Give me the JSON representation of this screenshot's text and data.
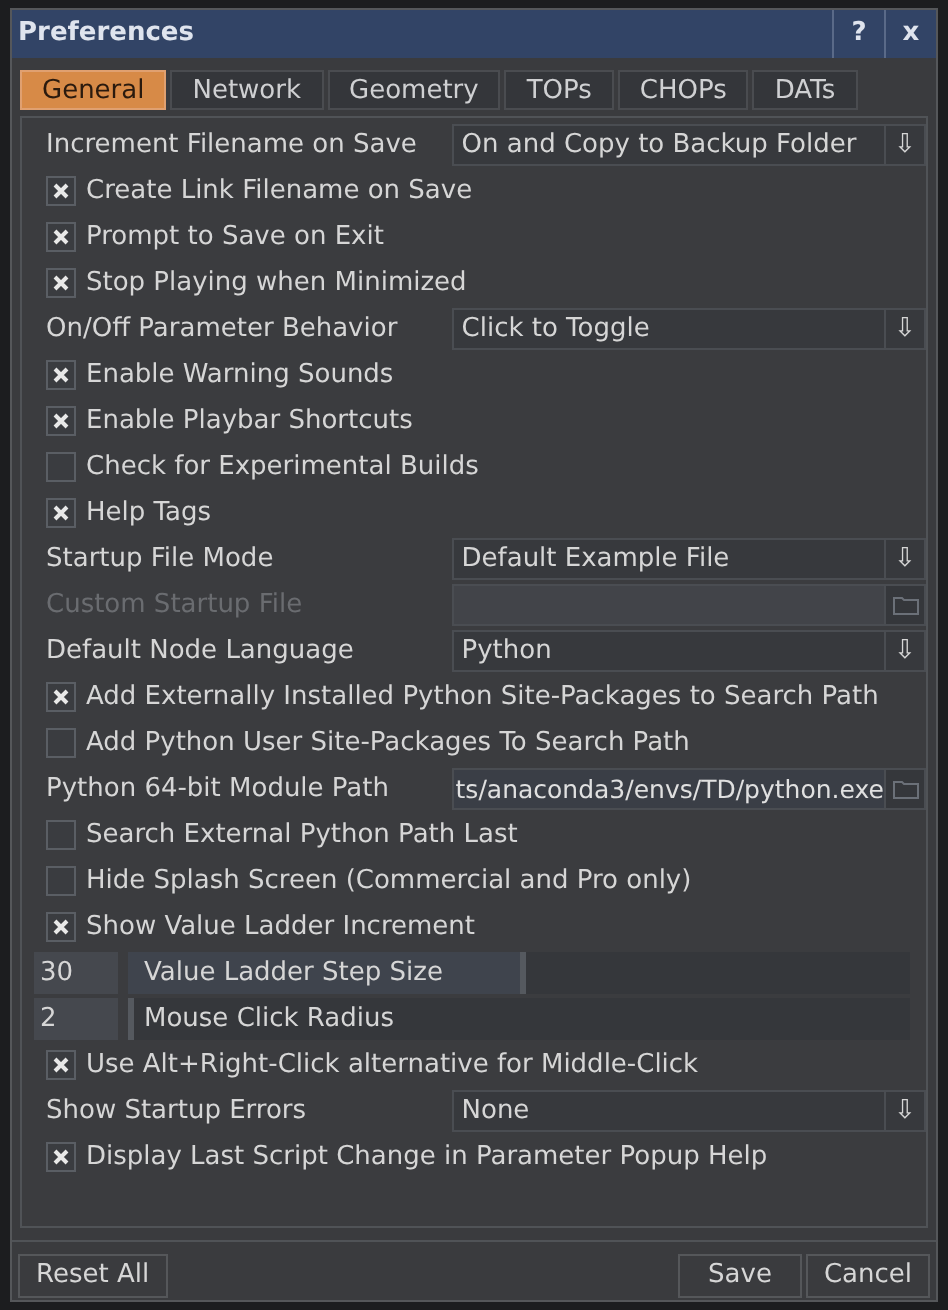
{
  "window": {
    "title": "Preferences",
    "help_button": "?",
    "close_button": "x"
  },
  "tabs": [
    {
      "label": "General",
      "selected": true
    },
    {
      "label": "Network",
      "selected": false
    },
    {
      "label": "Geometry",
      "selected": false
    },
    {
      "label": "TOPs",
      "selected": false
    },
    {
      "label": "CHOPs",
      "selected": false
    },
    {
      "label": "DATs",
      "selected": false
    }
  ],
  "rows": [
    {
      "kind": "menu",
      "label": "Increment Filename on Save",
      "value": "On and Copy to Backup Folder",
      "arrow": "⇩"
    },
    {
      "kind": "check",
      "label": "Create Link Filename on Save",
      "checked": true
    },
    {
      "kind": "check",
      "label": "Prompt to Save on Exit",
      "checked": true
    },
    {
      "kind": "check",
      "label": "Stop Playing when Minimized",
      "checked": true
    },
    {
      "kind": "menu",
      "label": "On/Off Parameter Behavior",
      "value": "Click to Toggle",
      "arrow": "⇩"
    },
    {
      "kind": "check",
      "label": "Enable Warning Sounds",
      "checked": true
    },
    {
      "kind": "check",
      "label": "Enable Playbar Shortcuts",
      "checked": true
    },
    {
      "kind": "check",
      "label": "Check for Experimental Builds",
      "checked": false
    },
    {
      "kind": "check",
      "label": "Help Tags",
      "checked": true
    },
    {
      "kind": "menu",
      "label": "Startup File Mode",
      "value": "Default Example File",
      "arrow": "⇩"
    },
    {
      "kind": "file",
      "label": "Custom Startup File",
      "disabled": true
    },
    {
      "kind": "menu",
      "label": "Default Node Language",
      "value": "Python",
      "arrow": "⇩"
    },
    {
      "kind": "check",
      "label": "Add Externally Installed Python Site-Packages to Search Path",
      "checked": true
    },
    {
      "kind": "check",
      "label": "Add Python User Site-Packages To Search Path",
      "checked": false
    },
    {
      "kind": "file",
      "label": "Python 64-bit Module Path",
      "value": "ts/anaconda3/envs/TD/python.exe",
      "disabled": false
    },
    {
      "kind": "check",
      "label": "Search External Python Path Last",
      "checked": false
    },
    {
      "kind": "check",
      "label": "Hide Splash Screen (Commercial and Pro only)",
      "checked": false
    },
    {
      "kind": "check",
      "label": "Show Value Ladder Increment",
      "checked": true
    },
    {
      "kind": "slider",
      "number": "30",
      "label": "Value Ladder Step Size",
      "level": 0.5
    },
    {
      "kind": "slider",
      "number": "2",
      "label": "Mouse Click Radius",
      "level": 0.0
    },
    {
      "kind": "check",
      "label": "Use Alt+Right-Click alternative for Middle-Click",
      "checked": true
    },
    {
      "kind": "menu",
      "label": "Show Startup Errors",
      "value": "None",
      "arrow": "⇩"
    },
    {
      "kind": "check",
      "label": "Display Last Script Change in Parameter Popup Help",
      "checked": true
    }
  ],
  "footer": {
    "reset": "Reset All",
    "save": "Save",
    "cancel": "Cancel"
  }
}
